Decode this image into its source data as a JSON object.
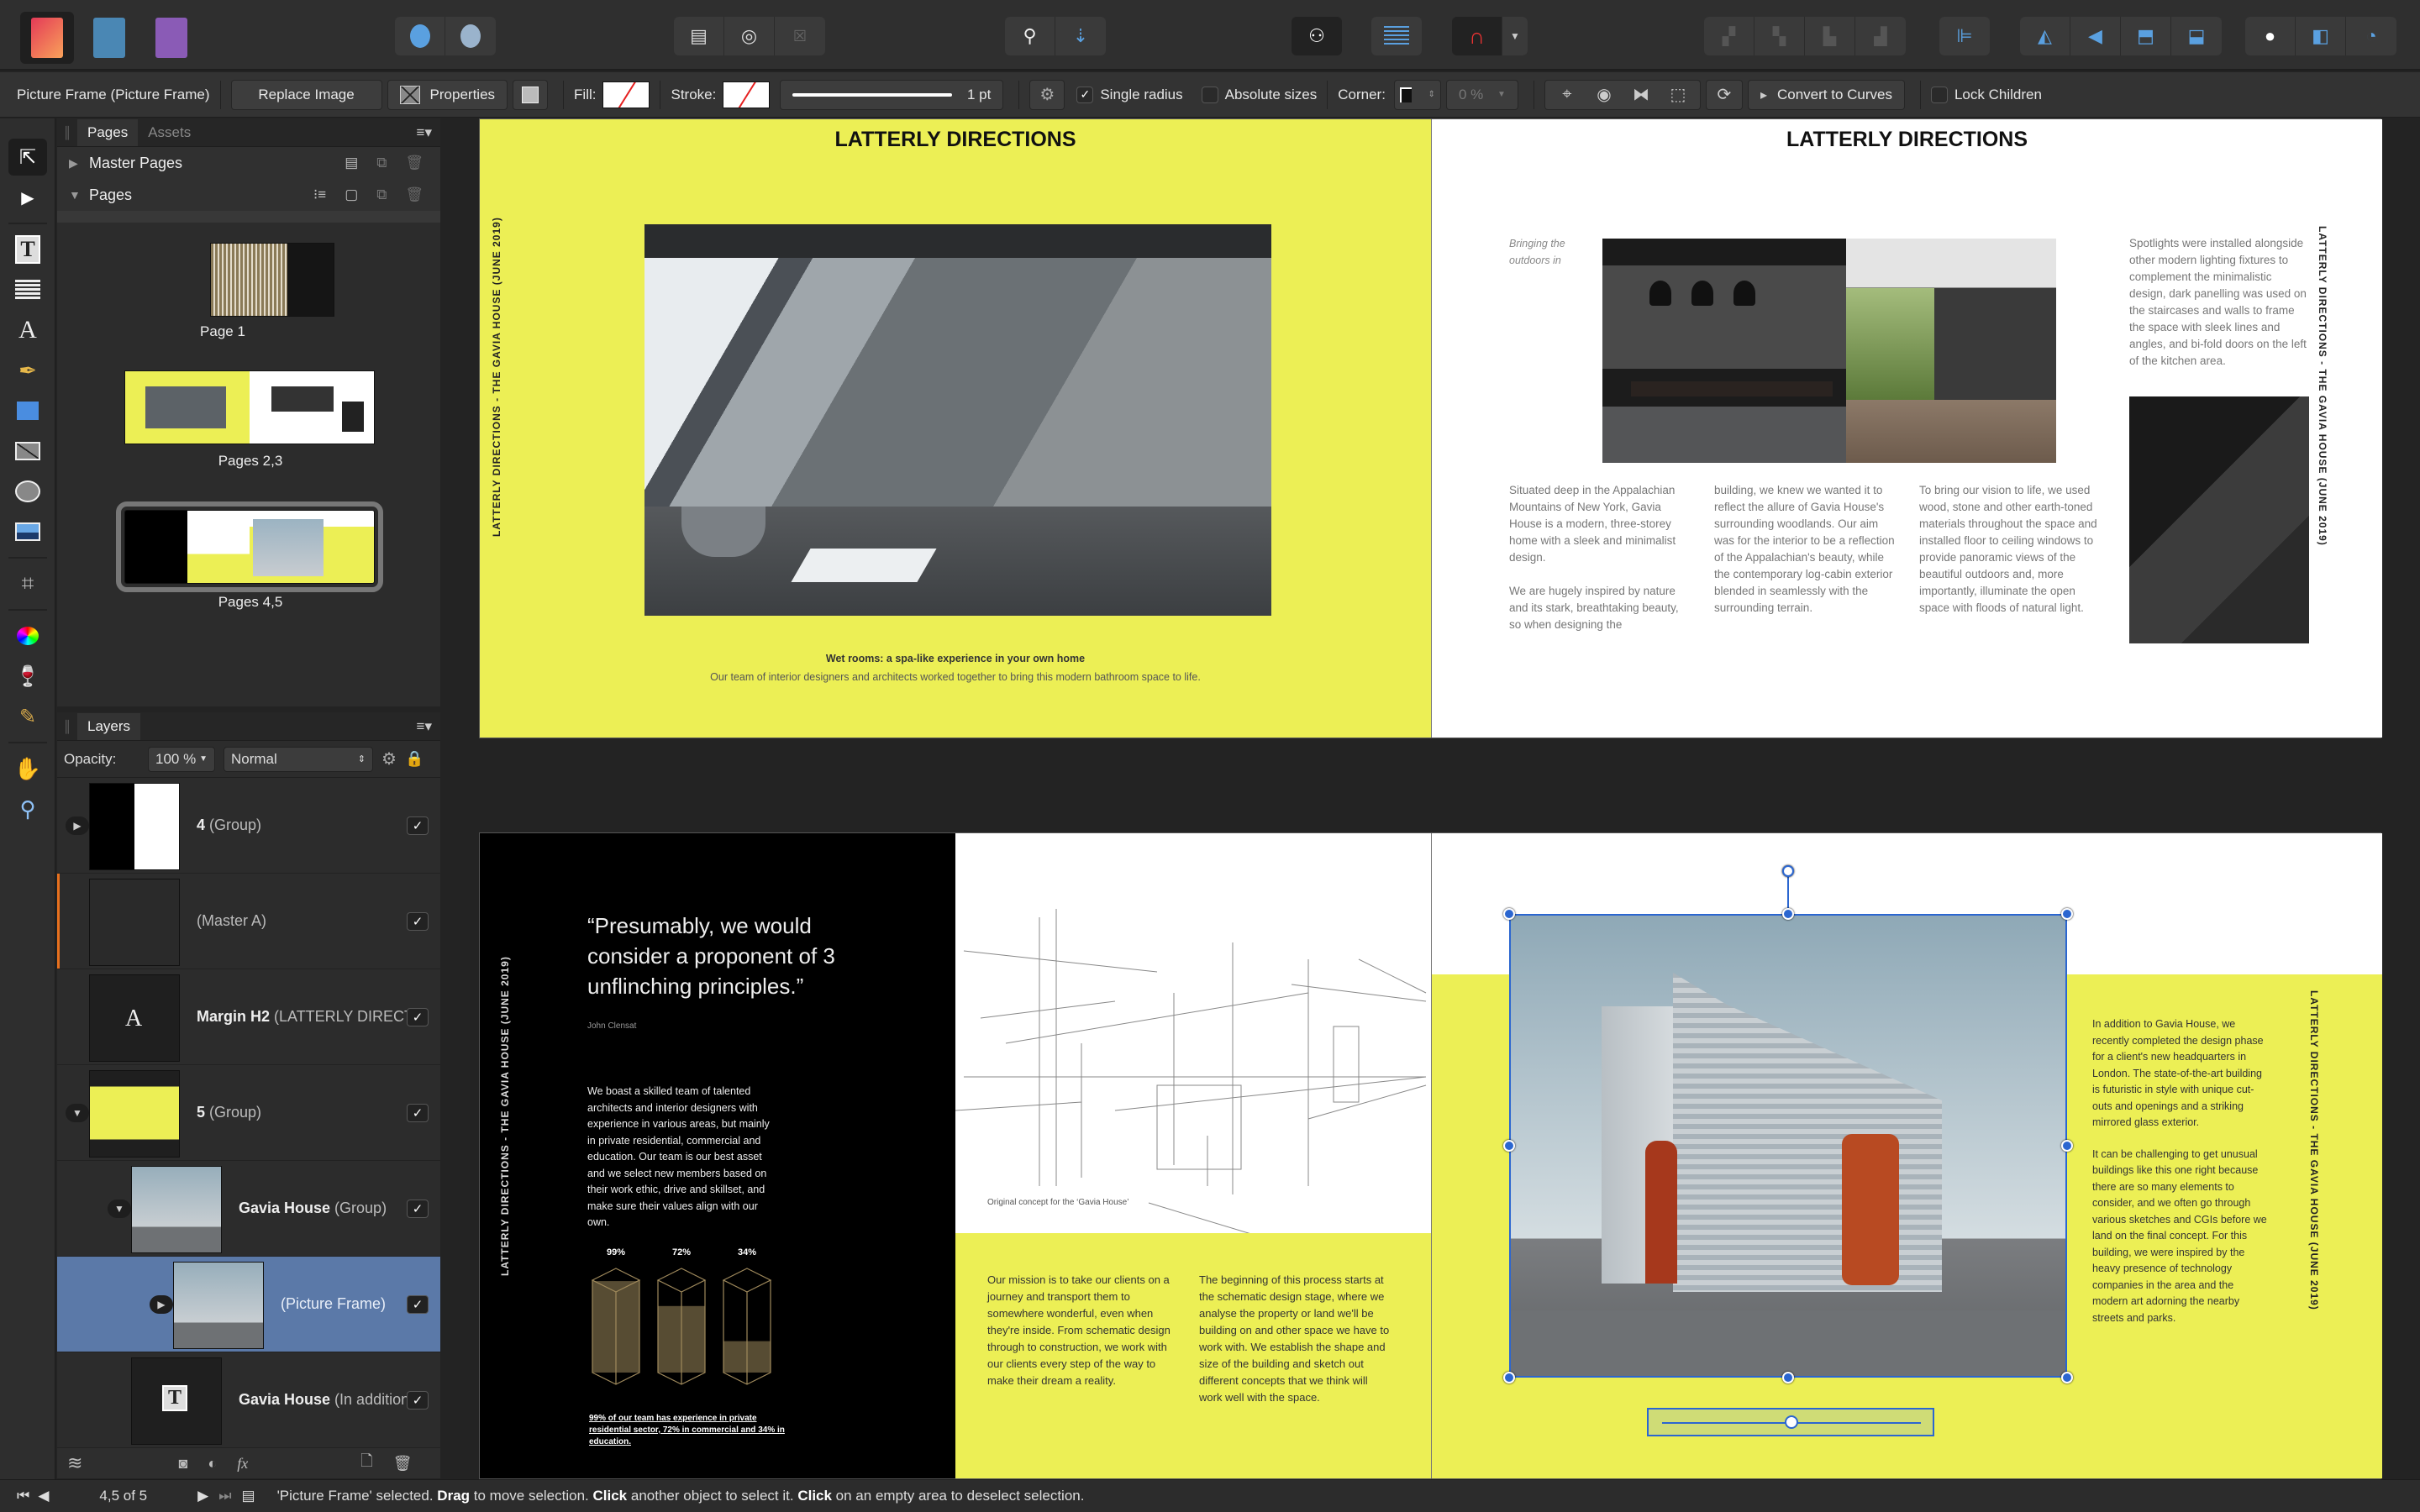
{
  "app": {
    "name": "Affinity Publisher",
    "personas": [
      "Publisher",
      "Designer",
      "Photo"
    ]
  },
  "context": {
    "selection_label": "Picture Frame  (Picture Frame)",
    "replace_image": "Replace Image",
    "properties": "Properties",
    "fill_label": "Fill:",
    "stroke_label": "Stroke:",
    "stroke_width": "1 pt",
    "single_radius": "Single radius",
    "single_radius_checked": true,
    "absolute_sizes": "Absolute sizes",
    "absolute_sizes_checked": false,
    "corner_label": "Corner:",
    "corner_value": "0 %",
    "convert_to_curves": "Convert to Curves",
    "lock_children": "Lock Children",
    "lock_children_checked": false
  },
  "pages_panel": {
    "tabs": [
      "Pages",
      "Assets"
    ],
    "active_tab": "Pages",
    "master_pages": "Master Pages",
    "pages_section": "Pages",
    "thumbnails": [
      {
        "label": "Page 1",
        "selected": false
      },
      {
        "label": "Pages 2,3",
        "selected": false
      },
      {
        "label": "Pages 4,5",
        "selected": true
      }
    ]
  },
  "layers_panel": {
    "title": "Layers",
    "opacity_label": "Opacity:",
    "opacity_value": "100 %",
    "blend_mode": "Normal",
    "layers": [
      {
        "name": "4",
        "type": "(Group)",
        "expanded": false,
        "visible": true,
        "selected": false,
        "depth": 0
      },
      {
        "name": "",
        "type": "(Master A)",
        "expanded": null,
        "visible": true,
        "selected": false,
        "depth": 0
      },
      {
        "name": "Margin H2",
        "type": "(LATTERLY DIRECT",
        "expanded": null,
        "visible": true,
        "selected": false,
        "depth": 0
      },
      {
        "name": "5",
        "type": "(Group)",
        "expanded": true,
        "visible": true,
        "selected": false,
        "depth": 0
      },
      {
        "name": "Gavia House",
        "type": "(Group)",
        "expanded": true,
        "visible": true,
        "selected": false,
        "depth": 1
      },
      {
        "name": "",
        "type": "(Picture Frame)",
        "expanded": false,
        "visible": true,
        "selected": true,
        "depth": 2
      },
      {
        "name": "Gavia House",
        "type": "(In addition to",
        "expanded": null,
        "visible": true,
        "selected": false,
        "depth": 1
      }
    ]
  },
  "spread1": {
    "left": {
      "headline": "LATTERLY DIRECTIONS",
      "side_label": "LATTERLY DIRECTIONS - THE GAVIA HOUSE (JUNE 2019)",
      "caption_title": "Wet rooms: a spa-like experience in your own home",
      "caption_body": "Our team of interior designers and architects worked together to bring this modern bathroom space to life."
    },
    "right": {
      "headline": "LATTERLY DIRECTIONS",
      "side_label": "LATTERLY DIRECTIONS - THE GAVIA HOUSE (JUNE 2019)",
      "pull_caption": "Bringing the outdoors in",
      "sidebar_text": "Spotlights were installed alongside other modern lighting fixtures to complement the minimalistic design, dark panelling was used on the staircases and walls to frame the space with sleek lines and angles, and bi-fold doors on the left of the kitchen area.",
      "col1_p1": "Situated deep in the Appalachian Mountains of New York, Gavia House is a modern, three-storey home with a sleek and minimalist design.",
      "col1_p2": "We are hugely inspired by nature and its stark, breathtaking beauty, so when designing the",
      "col2": "building, we knew we wanted it to reflect the allure of Gavia House's surrounding woodlands. Our aim was for the interior to be a reflection of the Appalachian's beauty, while the contemporary log-cabin exterior blended in seamlessly with the surrounding terrain.",
      "col3": "To bring our vision to life, we used wood, stone and other earth-toned materials throughout the space and installed floor to ceiling windows to provide panoramic views of the beautiful outdoors and, more importantly, illuminate the open space with floods of natural light."
    }
  },
  "spread2": {
    "left": {
      "side_label": "LATTERLY DIRECTIONS - THE GAVIA HOUSE (JUNE 2019)",
      "quote": "“Presumably, we would consider a proponent of 3 unflinching principles.”",
      "quote_author": "John Clensat",
      "team_text": "We boast a skilled team of talented architects and interior designers with experience in various areas, but mainly in private residential, commercial and education. Our team is our best asset and we select new members based on their work ethic, drive and skillset, and make sure their values align with our own.",
      "stats": [
        {
          "label": "99%",
          "value": 99
        },
        {
          "label": "72%",
          "value": 72
        },
        {
          "label": "34%",
          "value": 34
        }
      ],
      "stats_caption": "99% of our team has experience in private residential sector, 72% in commercial and 34% in education.",
      "sketch_caption": "Original concept for the ‘Gavia House’",
      "mission_text": "Our mission is to take our clients on a journey and transport them to somewhere wonderful, even when they're inside. From schematic design through to construction, we work with our clients every step of the way to make their dream a reality.",
      "process_text": "The beginning of this process starts at the schematic design stage, where we analyse the property or land we'll be building on and other space we have to work with. We establish the shape and size of the building and sketch out different concepts that we think will work well with the space."
    },
    "right": {
      "side_label": "LATTERLY DIRECTIONS - THE GAVIA HOUSE (JUNE 2019)",
      "p1": "In addition to Gavia House, we recently completed the design phase for a client's new headquarters in London. The state-of-the-art building is futuristic in style with unique cut-outs and openings and a striking mirrored glass exterior.",
      "p2": "It can be challenging to get unusual buildings like this one right because there are so many elements to consider, and we often go through various sketches and CGIs before we land on the final concept. For this building, we were inspired by the heavy presence of technology companies in the area and the modern art adorning the nearby streets and parks.",
      "image_scale": 0.5
    }
  },
  "status": {
    "page_indicator": "4,5 of 5",
    "msg_1": "'Picture Frame' selected. ",
    "msg_drag": "Drag",
    "msg_2": " to move selection. ",
    "msg_click1": "Click",
    "msg_3": " another object to select it. ",
    "msg_click2": "Click",
    "msg_4": " on an empty area to deselect selection."
  },
  "colors": {
    "accent_yellow": "#ecef55",
    "selection_blue": "#2b66d0",
    "layer_selected": "#5b79a8",
    "canvas": "#232323"
  }
}
